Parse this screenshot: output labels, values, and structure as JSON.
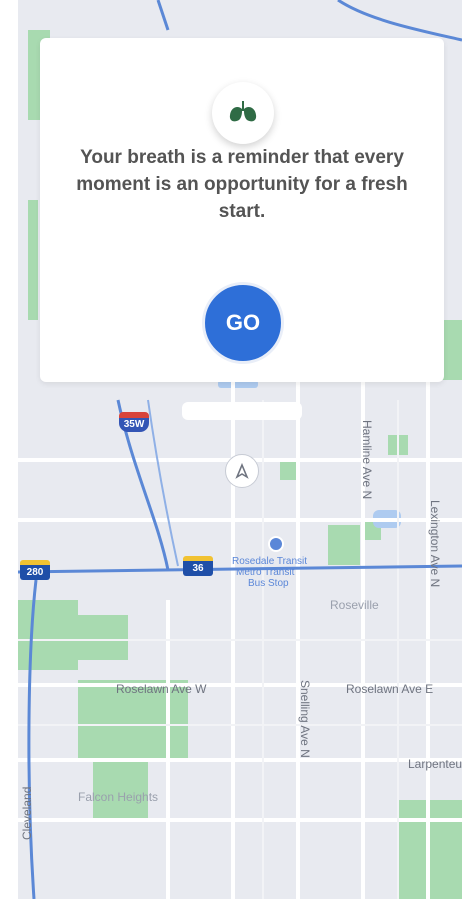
{
  "card": {
    "quote": "Your breath is a reminder that every moment is an opportunity for a fresh start.",
    "go_label": "GO",
    "icon": "lungs-icon"
  },
  "map": {
    "streets": {
      "rosedale_ave_w": "Roselawn Ave W",
      "roselawn_ave_e": "Roselawn Ave E",
      "snelling_ave_n": "Snelling Ave N",
      "hamline_ave_n": "Hamline Ave N",
      "lexington_ave_n": "Lexington Ave N",
      "larpenteur": "Larpenteur",
      "cleveland": "Cleveland"
    },
    "poi": {
      "line1": "Rosedale Transit",
      "line2": "Metro Transit",
      "line3": "Bus Stop"
    },
    "neighborhood": "Falcon Heights",
    "area": "Roseville",
    "shields": {
      "i35w": "35W",
      "hwy36_west": "280",
      "hwy36_east": "36"
    },
    "colors": {
      "background": "#e8eaf0",
      "park": "#a8dab0",
      "highway": "#5b88d6",
      "road": "#ffffff",
      "water": "#aecbf0"
    }
  },
  "colors": {
    "go_button": "#2e6fd8",
    "quote_text": "#545454",
    "lung_icon": "#2f6b45"
  }
}
